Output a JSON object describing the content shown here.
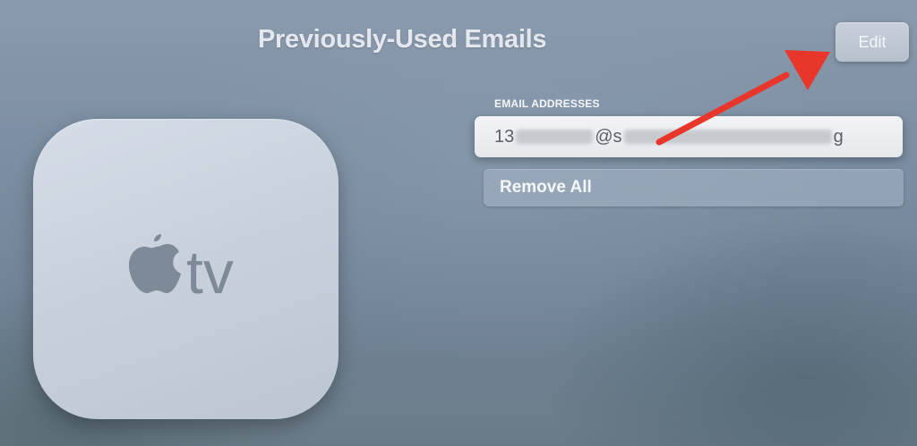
{
  "header": {
    "title": "Previously-Used Emails",
    "edit_label": "Edit"
  },
  "emails": {
    "section_label": "EMAIL ADDRESSES",
    "items": [
      {
        "prefix": "13",
        "mid": "@s",
        "suffix": "g"
      }
    ]
  },
  "actions": {
    "remove_all_label": "Remove All"
  },
  "logo": {
    "icon": "apple-tv-logo",
    "text": "tv"
  },
  "annotation": {
    "icon": "red-arrow-icon",
    "color": "#e8372a"
  }
}
